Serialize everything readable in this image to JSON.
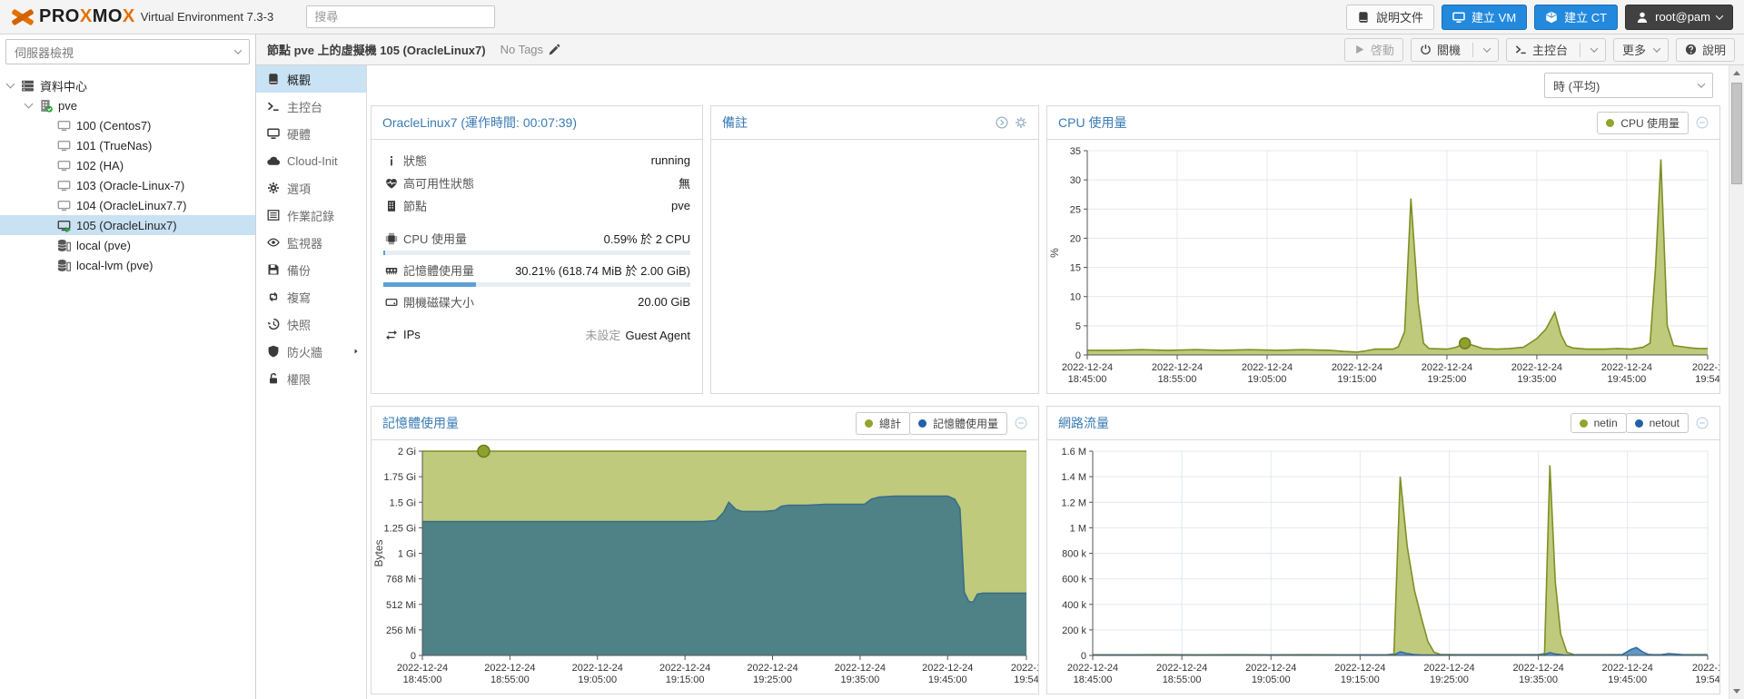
{
  "topbar": {
    "brand_p1": "PRO",
    "brand_x1": "X",
    "brand_p2": "MO",
    "brand_x2": "X",
    "subtitle": "Virtual Environment 7.3-3",
    "search_placeholder": "搜尋",
    "docs_label": "說明文件",
    "create_vm_label": "建立 VM",
    "create_ct_label": "建立 CT",
    "user_label": "root@pam"
  },
  "sidebar": {
    "view_label": "伺服器檢視",
    "tree": [
      {
        "icon": "server",
        "label": "資料中心",
        "level": 0,
        "expanded": true
      },
      {
        "icon": "node",
        "label": "pve",
        "level": 1,
        "expanded": true
      },
      {
        "icon": "vm",
        "label": "100 (Centos7)",
        "level": 2
      },
      {
        "icon": "vm",
        "label": "101 (TrueNas)",
        "level": 2
      },
      {
        "icon": "vm",
        "label": "102 (HA)",
        "level": 2
      },
      {
        "icon": "vm",
        "label": "103 (Oracle-Linux-7)",
        "level": 2
      },
      {
        "icon": "vm",
        "label": "104 (OracleLinux7.7)",
        "level": 2
      },
      {
        "icon": "vm-running",
        "label": "105 (OracleLinux7)",
        "level": 2,
        "selected": true
      },
      {
        "icon": "storage",
        "label": "local (pve)",
        "level": 2
      },
      {
        "icon": "storage",
        "label": "local-lvm (pve)",
        "level": 2
      }
    ]
  },
  "breadcrumb": {
    "title": "節點 pve 上的虛擬機 105 (OracleLinux7)",
    "tags_label": "No Tags"
  },
  "actions": [
    {
      "icon": "play",
      "label": "啓動",
      "disabled": true
    },
    {
      "icon": "power",
      "label": "關機",
      "split": true
    },
    {
      "icon": "terminal",
      "label": "主控台",
      "split": true
    },
    {
      "label": "更多",
      "caret": true
    },
    {
      "icon": "question",
      "label": "說明"
    }
  ],
  "nav": [
    {
      "icon": "book",
      "label": "概觀",
      "selected": true
    },
    {
      "icon": "terminal",
      "label": "主控台"
    },
    {
      "icon": "display",
      "label": "硬體"
    },
    {
      "icon": "cloud",
      "label": "Cloud-Init"
    },
    {
      "icon": "gear",
      "label": "選項"
    },
    {
      "icon": "list",
      "label": "作業記錄"
    },
    {
      "icon": "eye",
      "label": "監視器"
    },
    {
      "icon": "floppy",
      "label": "備份"
    },
    {
      "icon": "retweet",
      "label": "複寫"
    },
    {
      "icon": "history",
      "label": "快照"
    },
    {
      "icon": "shield",
      "label": "防火牆",
      "submenu": true
    },
    {
      "icon": "unlock",
      "label": "權限"
    }
  ],
  "period_select": {
    "value": "時 (平均)"
  },
  "status_panel": {
    "title": "OracleLinux7 (運作時間: 00:07:39)",
    "rows": [
      {
        "icon": "info",
        "label": "狀態",
        "value": "running"
      },
      {
        "icon": "heart",
        "label": "高可用性狀態",
        "value": "無"
      },
      {
        "icon": "building",
        "label": "節點",
        "value": "pve"
      },
      {
        "icon": "cpu",
        "label": "CPU 使用量",
        "value": "0.59% 於 2 CPU",
        "bar": 0.59,
        "gap": true
      },
      {
        "icon": "memory",
        "label": "記憶體使用量",
        "value": "30.21% (618.74 MiB 於 2.00 GiB)",
        "bar": 30.21
      },
      {
        "icon": "disk",
        "label": "開機磁碟大小",
        "value": "20.00 GiB"
      },
      {
        "icon": "arrows",
        "label": "IPs",
        "label_dark": true,
        "value_muted": "未設定",
        "value": "Guest Agent",
        "gap": true
      }
    ]
  },
  "notes_panel": {
    "title": "備註"
  },
  "chart_data": [
    {
      "type": "area",
      "title": "CPU 使用量",
      "ylabel": "%",
      "xlim": [
        0,
        69
      ],
      "ylim": [
        0,
        35
      ],
      "x_ticks": [
        {
          "x": 0,
          "d": "2022-12-24",
          "t": "18:45:00"
        },
        {
          "x": 10,
          "d": "2022-12-24",
          "t": "18:55:00"
        },
        {
          "x": 20,
          "d": "2022-12-24",
          "t": "19:05:00"
        },
        {
          "x": 30,
          "d": "2022-12-24",
          "t": "19:15:00"
        },
        {
          "x": 40,
          "d": "2022-12-24",
          "t": "19:25:00"
        },
        {
          "x": 50,
          "d": "2022-12-24",
          "t": "19:35:00"
        },
        {
          "x": 60,
          "d": "2022-12-24",
          "t": "19:45:00"
        },
        {
          "x": 69,
          "d": "2022-1",
          "t": "19:54"
        }
      ],
      "y_ticks": [
        {
          "v": 0,
          "l": "0"
        },
        {
          "v": 5,
          "l": "5"
        },
        {
          "v": 10,
          "l": "10"
        },
        {
          "v": 15,
          "l": "15"
        },
        {
          "v": 20,
          "l": "20"
        },
        {
          "v": 25,
          "l": "25"
        },
        {
          "v": 30,
          "l": "30"
        },
        {
          "v": 35,
          "l": "35"
        }
      ],
      "series": [
        {
          "name": "CPU 使用量",
          "dot": "#94a32c",
          "line": "#7f8f24",
          "fill": "#bfca7d",
          "points": [
            [
              0,
              0.8
            ],
            [
              3,
              0.8
            ],
            [
              6,
              0.9
            ],
            [
              9,
              0.8
            ],
            [
              12,
              0.9
            ],
            [
              15,
              0.8
            ],
            [
              18,
              0.9
            ],
            [
              21,
              0.8
            ],
            [
              24,
              0.9
            ],
            [
              27,
              0.8
            ],
            [
              28.5,
              0.6
            ],
            [
              30,
              0.5
            ],
            [
              31,
              0.7
            ],
            [
              32,
              1
            ],
            [
              34,
              1
            ],
            [
              34.6,
              1.4
            ],
            [
              35.3,
              4
            ],
            [
              36,
              26.8
            ],
            [
              36.8,
              9
            ],
            [
              37.4,
              2
            ],
            [
              38,
              1.1
            ],
            [
              40,
              1
            ],
            [
              41,
              1.3
            ],
            [
              42,
              2
            ],
            [
              43,
              1.6
            ],
            [
              44,
              1.1
            ],
            [
              45.5,
              1
            ],
            [
              47,
              1.1
            ],
            [
              48.5,
              1.3
            ],
            [
              50,
              2.8
            ],
            [
              51,
              4.4
            ],
            [
              52,
              7.3
            ],
            [
              52.7,
              3.4
            ],
            [
              53.3,
              1.6
            ],
            [
              54,
              1.2
            ],
            [
              55.5,
              1
            ],
            [
              57.5,
              1
            ],
            [
              59,
              1.1
            ],
            [
              60.5,
              1
            ],
            [
              61.8,
              1.3
            ],
            [
              62.6,
              2
            ],
            [
              63.2,
              15
            ],
            [
              63.8,
              33.5
            ],
            [
              64.5,
              5
            ],
            [
              65.2,
              1.6
            ],
            [
              66.2,
              1.4
            ],
            [
              67.2,
              1.2
            ],
            [
              68,
              1.1
            ],
            [
              69,
              1.1
            ]
          ]
        }
      ],
      "markers": [
        {
          "x": 42,
          "y": 2,
          "r": 6,
          "fill": "#8da12d",
          "stroke": "#6c7a1c"
        }
      ]
    },
    {
      "type": "area",
      "title": "記憶體使用量",
      "ylabel": "Bytes",
      "xlim": [
        0,
        69
      ],
      "ylim": [
        0,
        2
      ],
      "x_ticks": [
        {
          "x": 0,
          "d": "2022-12-24",
          "t": "18:45:00"
        },
        {
          "x": 10,
          "d": "2022-12-24",
          "t": "18:55:00"
        },
        {
          "x": 20,
          "d": "2022-12-24",
          "t": "19:05:00"
        },
        {
          "x": 30,
          "d": "2022-12-24",
          "t": "19:15:00"
        },
        {
          "x": 40,
          "d": "2022-12-24",
          "t": "19:25:00"
        },
        {
          "x": 50,
          "d": "2022-12-24",
          "t": "19:35:00"
        },
        {
          "x": 60,
          "d": "2022-12-24",
          "t": "19:45:00"
        },
        {
          "x": 69,
          "d": "2022-1",
          "t": "19:54"
        }
      ],
      "y_ticks": [
        {
          "v": 0,
          "l": "0"
        },
        {
          "v": 0.25,
          "l": "256 Mi"
        },
        {
          "v": 0.5,
          "l": "512 Mi"
        },
        {
          "v": 0.75,
          "l": "768 Mi"
        },
        {
          "v": 1,
          "l": "1 Gi"
        },
        {
          "v": 1.25,
          "l": "1.25 Gi"
        },
        {
          "v": 1.5,
          "l": "1.5 Gi"
        },
        {
          "v": 1.75,
          "l": "1.75 Gi"
        },
        {
          "v": 2,
          "l": "2 Gi"
        }
      ],
      "series": [
        {
          "name": "總計",
          "dot": "#94a32c",
          "line": "#7f8f24",
          "fill": "#bfca7d",
          "points": [
            [
              0,
              2
            ],
            [
              69,
              2
            ]
          ]
        },
        {
          "name": "記憶體使用量",
          "dot": "#1e62a7",
          "line": "#386e87",
          "fill": "#4f8287",
          "points": [
            [
              0,
              1.31
            ],
            [
              32,
              1.31
            ],
            [
              33.5,
              1.32
            ],
            [
              34.4,
              1.4
            ],
            [
              35,
              1.5
            ],
            [
              35.8,
              1.43
            ],
            [
              36.5,
              1.41
            ],
            [
              39,
              1.41
            ],
            [
              40.3,
              1.42
            ],
            [
              41,
              1.46
            ],
            [
              41.8,
              1.47
            ],
            [
              44,
              1.47
            ],
            [
              46,
              1.48
            ],
            [
              48,
              1.48
            ],
            [
              50.5,
              1.48
            ],
            [
              51.3,
              1.53
            ],
            [
              52.2,
              1.55
            ],
            [
              54,
              1.56
            ],
            [
              56,
              1.56
            ],
            [
              58,
              1.56
            ],
            [
              60,
              1.56
            ],
            [
              60.8,
              1.53
            ],
            [
              61.4,
              1.44
            ],
            [
              61.9,
              0.62
            ],
            [
              62.4,
              0.53
            ],
            [
              62.9,
              0.52
            ],
            [
              63.4,
              0.6
            ],
            [
              64,
              0.61
            ],
            [
              66,
              0.61
            ],
            [
              69,
              0.61
            ]
          ]
        }
      ],
      "markers": [
        {
          "x": 7,
          "y": 2,
          "r": 6.5,
          "fill": "#8da12d",
          "stroke": "#6c7a1c"
        }
      ]
    },
    {
      "type": "area",
      "title": "網路流量",
      "ylabel": "",
      "xlim": [
        0,
        69
      ],
      "ylim": [
        0,
        1600
      ],
      "x_ticks": [
        {
          "x": 0,
          "d": "2022-12-24",
          "t": "18:45:00"
        },
        {
          "x": 10,
          "d": "2022-12-24",
          "t": "18:55:00"
        },
        {
          "x": 20,
          "d": "2022-12-24",
          "t": "19:05:00"
        },
        {
          "x": 30,
          "d": "2022-12-24",
          "t": "19:15:00"
        },
        {
          "x": 40,
          "d": "2022-12-24",
          "t": "19:25:00"
        },
        {
          "x": 50,
          "d": "2022-12-24",
          "t": "19:35:00"
        },
        {
          "x": 60,
          "d": "2022-12-24",
          "t": "19:45:00"
        },
        {
          "x": 69,
          "d": "2022-1",
          "t": "19:54"
        }
      ],
      "y_ticks": [
        {
          "v": 0,
          "l": "0"
        },
        {
          "v": 200,
          "l": "200 k"
        },
        {
          "v": 400,
          "l": "400 k"
        },
        {
          "v": 600,
          "l": "600 k"
        },
        {
          "v": 800,
          "l": "800 k"
        },
        {
          "v": 1000,
          "l": "1 M"
        },
        {
          "v": 1200,
          "l": "1.2 M"
        },
        {
          "v": 1400,
          "l": "1.4 M"
        },
        {
          "v": 1600,
          "l": "1.6 M"
        }
      ],
      "series": [
        {
          "name": "netin",
          "dot": "#94a32c",
          "line": "#7f8f24",
          "fill": "#bfca7d",
          "points": [
            [
              0,
              5
            ],
            [
              4,
              5
            ],
            [
              8,
              6
            ],
            [
              12,
              5
            ],
            [
              16,
              6
            ],
            [
              20,
              5
            ],
            [
              24,
              6
            ],
            [
              28,
              5
            ],
            [
              31,
              5
            ],
            [
              33,
              5
            ],
            [
              33.8,
              12
            ],
            [
              34.5,
              1400
            ],
            [
              35.3,
              850
            ],
            [
              36.1,
              510
            ],
            [
              36.9,
              290
            ],
            [
              37.6,
              110
            ],
            [
              38.3,
              25
            ],
            [
              39,
              8
            ],
            [
              41,
              6
            ],
            [
              44,
              6
            ],
            [
              47,
              6
            ],
            [
              50,
              6
            ],
            [
              50.7,
              15
            ],
            [
              51.3,
              1490
            ],
            [
              51.9,
              580
            ],
            [
              52.5,
              170
            ],
            [
              53.2,
              25
            ],
            [
              54,
              7
            ],
            [
              56,
              6
            ],
            [
              58,
              6
            ],
            [
              60,
              6
            ],
            [
              62,
              6
            ],
            [
              64,
              6
            ],
            [
              66,
              6
            ],
            [
              68,
              6
            ],
            [
              69,
              6
            ]
          ]
        },
        {
          "name": "netout",
          "dot": "#1e62a7",
          "line": "#2e6da4",
          "fill": "#6196c6",
          "points": [
            [
              0,
              2
            ],
            [
              5,
              2
            ],
            [
              10,
              2
            ],
            [
              15,
              2
            ],
            [
              20,
              2
            ],
            [
              25,
              2
            ],
            [
              30,
              3
            ],
            [
              33.8,
              3
            ],
            [
              34.5,
              28
            ],
            [
              35.2,
              16
            ],
            [
              36,
              7
            ],
            [
              37,
              3
            ],
            [
              40,
              3
            ],
            [
              44,
              3
            ],
            [
              48,
              3
            ],
            [
              50.6,
              5
            ],
            [
              51.3,
              22
            ],
            [
              52,
              10
            ],
            [
              52.8,
              4
            ],
            [
              55,
              3
            ],
            [
              57.5,
              3
            ],
            [
              59.4,
              6
            ],
            [
              60.4,
              46
            ],
            [
              61,
              62
            ],
            [
              61.7,
              28
            ],
            [
              62.3,
              8
            ],
            [
              63,
              4
            ],
            [
              63.8,
              5
            ],
            [
              64.6,
              14
            ],
            [
              65.4,
              11
            ],
            [
              66.2,
              5
            ],
            [
              67,
              3
            ],
            [
              68,
              3
            ],
            [
              69,
              3
            ]
          ]
        }
      ],
      "markers": []
    }
  ]
}
